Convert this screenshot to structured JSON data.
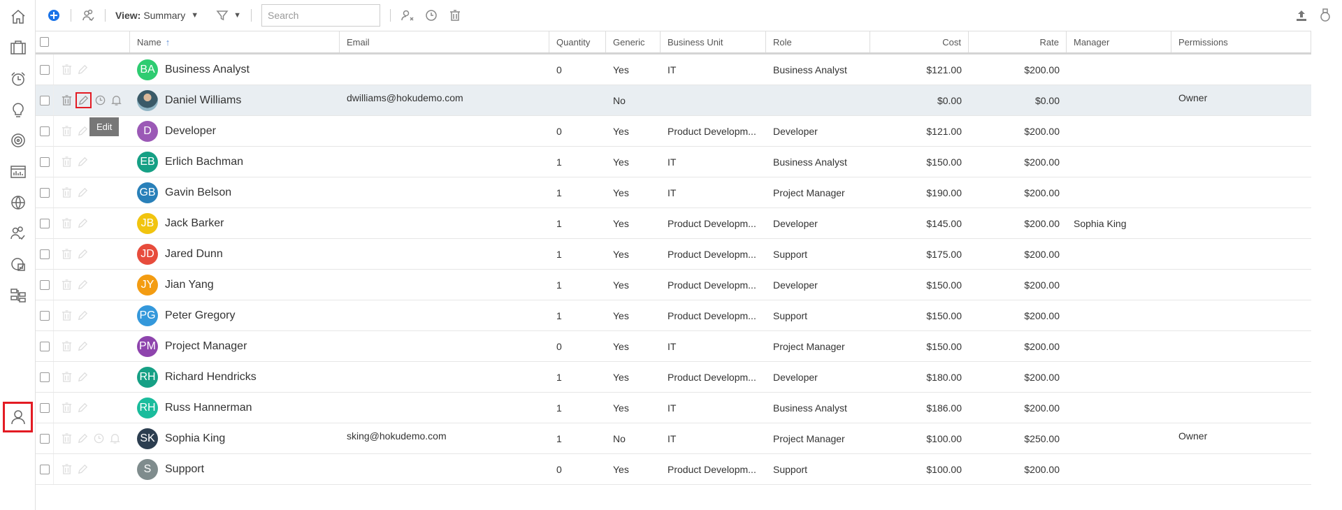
{
  "sidebar": {
    "items": [
      {
        "icon": "home-icon"
      },
      {
        "icon": "briefcase-icon"
      },
      {
        "icon": "timer-icon"
      },
      {
        "icon": "lightbulb-icon"
      },
      {
        "icon": "target-icon"
      },
      {
        "icon": "chart-icon"
      },
      {
        "icon": "globe-icon"
      },
      {
        "icon": "people-check-icon"
      },
      {
        "icon": "report-icon"
      },
      {
        "icon": "hierarchy-icon"
      },
      {
        "icon": "user-icon",
        "active": true
      }
    ]
  },
  "toolbar": {
    "view_label": "View:",
    "view_value": "Summary",
    "search_placeholder": "Search"
  },
  "columns": [
    "Name",
    "Email",
    "Quantity",
    "Generic",
    "Business Unit",
    "Role",
    "Cost",
    "Rate",
    "Manager",
    "Permissions"
  ],
  "tooltip": "Edit",
  "rows": [
    {
      "initials": "BA",
      "color": "#2ecc71",
      "name": "Business Analyst",
      "email": "",
      "qty": "0",
      "generic": "Yes",
      "bu": "IT",
      "role": "Business Analyst",
      "cost": "$121.00",
      "rate": "$200.00",
      "manager": "",
      "perm": ""
    },
    {
      "initials": "",
      "photo": true,
      "color": "#4a6a78",
      "name": "Daniel Williams",
      "email": "dwilliams@hokudemo.com",
      "qty": "",
      "generic": "No",
      "bu": "",
      "role": "",
      "cost": "$0.00",
      "rate": "$0.00",
      "manager": "",
      "perm": "Owner",
      "highlight": true
    },
    {
      "initials": "D",
      "color": "#9b59b6",
      "name": "Developer",
      "email": "",
      "qty": "0",
      "generic": "Yes",
      "bu": "Product Developm...",
      "role": "Developer",
      "cost": "$121.00",
      "rate": "$200.00",
      "manager": "",
      "perm": ""
    },
    {
      "initials": "EB",
      "color": "#16a085",
      "name": "Erlich Bachman",
      "email": "",
      "qty": "1",
      "generic": "Yes",
      "bu": "IT",
      "role": "Business Analyst",
      "cost": "$150.00",
      "rate": "$200.00",
      "manager": "",
      "perm": ""
    },
    {
      "initials": "GB",
      "color": "#2980b9",
      "name": "Gavin Belson",
      "email": "",
      "qty": "1",
      "generic": "Yes",
      "bu": "IT",
      "role": "Project Manager",
      "cost": "$190.00",
      "rate": "$200.00",
      "manager": "",
      "perm": ""
    },
    {
      "initials": "JB",
      "color": "#f1c40f",
      "name": "Jack Barker",
      "email": "",
      "qty": "1",
      "generic": "Yes",
      "bu": "Product Developm...",
      "role": "Developer",
      "cost": "$145.00",
      "rate": "$200.00",
      "manager": "Sophia King",
      "perm": ""
    },
    {
      "initials": "JD",
      "color": "#e74c3c",
      "name": "Jared Dunn",
      "email": "",
      "qty": "1",
      "generic": "Yes",
      "bu": "Product Developm...",
      "role": "Support",
      "cost": "$175.00",
      "rate": "$200.00",
      "manager": "",
      "perm": ""
    },
    {
      "initials": "JY",
      "color": "#f39c12",
      "name": "Jian Yang",
      "email": "",
      "qty": "1",
      "generic": "Yes",
      "bu": "Product Developm...",
      "role": "Developer",
      "cost": "$150.00",
      "rate": "$200.00",
      "manager": "",
      "perm": ""
    },
    {
      "initials": "PG",
      "color": "#3498db",
      "name": "Peter Gregory",
      "email": "",
      "qty": "1",
      "generic": "Yes",
      "bu": "Product Developm...",
      "role": "Support",
      "cost": "$150.00",
      "rate": "$200.00",
      "manager": "",
      "perm": ""
    },
    {
      "initials": "PM",
      "color": "#8e44ad",
      "name": "Project Manager",
      "email": "",
      "qty": "0",
      "generic": "Yes",
      "bu": "IT",
      "role": "Project Manager",
      "cost": "$150.00",
      "rate": "$200.00",
      "manager": "",
      "perm": ""
    },
    {
      "initials": "RH",
      "color": "#16a085",
      "name": "Richard Hendricks",
      "email": "",
      "qty": "1",
      "generic": "Yes",
      "bu": "Product Developm...",
      "role": "Developer",
      "cost": "$180.00",
      "rate": "$200.00",
      "manager": "",
      "perm": ""
    },
    {
      "initials": "RH",
      "color": "#1abc9c",
      "name": "Russ Hannerman",
      "email": "",
      "qty": "1",
      "generic": "Yes",
      "bu": "IT",
      "role": "Business Analyst",
      "cost": "$186.00",
      "rate": "$200.00",
      "manager": "",
      "perm": ""
    },
    {
      "initials": "SK",
      "color": "#2c3e50",
      "name": "Sophia King",
      "email": "sking@hokudemo.com",
      "qty": "1",
      "generic": "No",
      "bu": "IT",
      "role": "Project Manager",
      "cost": "$100.00",
      "rate": "$250.00",
      "manager": "",
      "perm": "Owner"
    },
    {
      "initials": "S",
      "color": "#7f8c8d",
      "name": "Support",
      "email": "",
      "qty": "0",
      "generic": "Yes",
      "bu": "Product Developm...",
      "role": "Support",
      "cost": "$100.00",
      "rate": "$200.00",
      "manager": "",
      "perm": ""
    }
  ]
}
